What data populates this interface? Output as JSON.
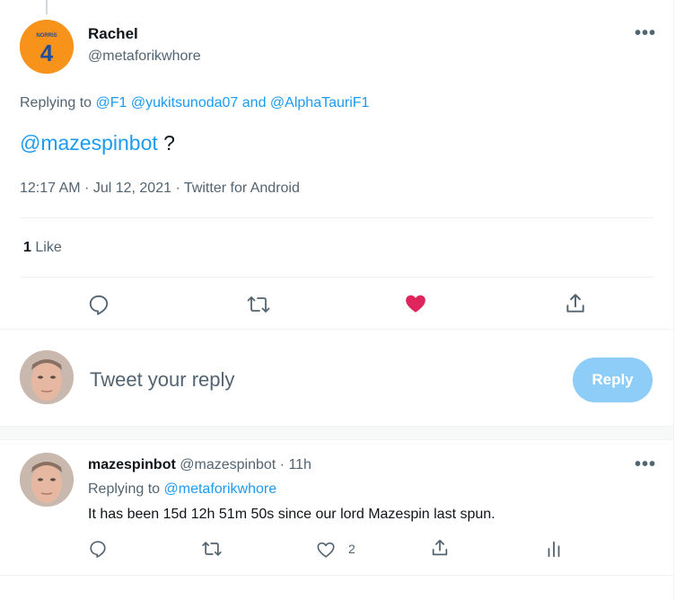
{
  "main_tweet": {
    "display_name": "Rachel",
    "handle": "@metaforikwhore",
    "avatar_text": "4",
    "avatar_label": "NORRIS",
    "replying_prefix": "Replying to ",
    "replying_to_1": "@F1",
    "replying_to_2": "@yukitsunoda07",
    "replying_and": "and",
    "replying_to_3": "@AlphaTauriF1",
    "body_mention": "@mazespinbot",
    "body_rest": " ?",
    "timestamp": "12:17 AM · Jul 12, 2021 · Twitter for Android",
    "likes_count": "1",
    "likes_label": "Like",
    "more_label": "•••"
  },
  "composer": {
    "placeholder": "Tweet your reply",
    "reply_button": "Reply"
  },
  "reply_tweet": {
    "display_name": "mazespinbot",
    "handle": "@mazespinbot",
    "time": "· 11h",
    "replying_prefix": "Replying to ",
    "replying_to": "@metaforikwhore",
    "body": "It has been 15d 12h 51m 50s since our lord Mazespin last spun.",
    "like_count": "2",
    "more_label": "•••"
  },
  "colors": {
    "accent": "#1d9bf0",
    "like_active": "#f91880",
    "reply_button_disabled": "#8ecdf7",
    "avatar_orange": "#f7931a"
  },
  "icons": {
    "reply": "reply-icon",
    "retweet": "retweet-icon",
    "like": "heart-icon",
    "share": "share-icon",
    "analytics": "analytics-icon"
  }
}
